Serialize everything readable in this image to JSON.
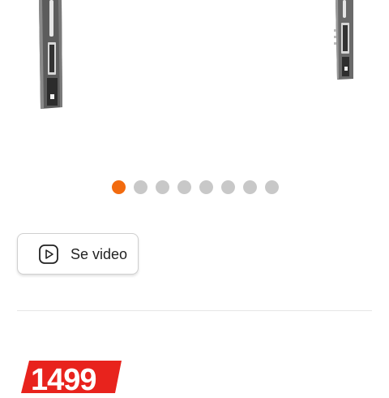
{
  "carousel": {
    "dot_count": 8,
    "active_index": 0,
    "colors": {
      "active": "#f26b0f",
      "inactive": "#c8c8c8"
    }
  },
  "video_button": {
    "label": "Se video",
    "icon": "play-icon"
  },
  "price": {
    "value": "1499",
    "tag_color": "#e8231d"
  }
}
